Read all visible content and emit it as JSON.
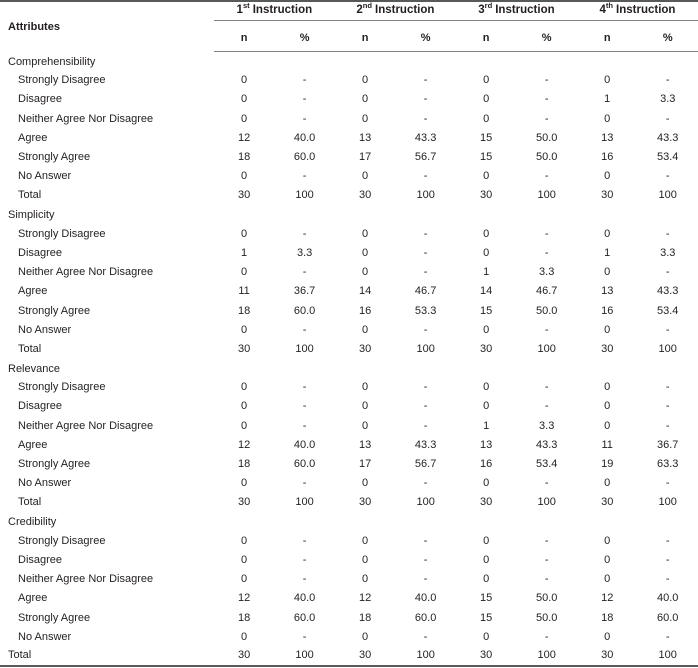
{
  "table": {
    "attributes_header": "Attributes",
    "column_groups": [
      {
        "ordinal": "1",
        "suffix": "st",
        "label": "Instruction"
      },
      {
        "ordinal": "2",
        "suffix": "nd",
        "label": "Instruction"
      },
      {
        "ordinal": "3",
        "suffix": "rd",
        "label": "Instruction"
      },
      {
        "ordinal": "4",
        "suffix": "th",
        "label": "Instruction"
      }
    ],
    "subheaders": [
      "n",
      "%",
      "n",
      "%",
      "n",
      "%",
      "n",
      "%"
    ],
    "sections": [
      {
        "name": "Comprehensibility",
        "rows": [
          {
            "label": "Strongly Disagree",
            "values": [
              "0",
              "-",
              "0",
              "-",
              "0",
              "-",
              "0",
              "-"
            ]
          },
          {
            "label": "Disagree",
            "values": [
              "0",
              "-",
              "0",
              "-",
              "0",
              "-",
              "1",
              "3.3"
            ]
          },
          {
            "label": "Neither Agree Nor Disagree",
            "values": [
              "0",
              "-",
              "0",
              "-",
              "0",
              "-",
              "0",
              "-"
            ]
          },
          {
            "label": "Agree",
            "values": [
              "12",
              "40.0",
              "13",
              "43.3",
              "15",
              "50.0",
              "13",
              "43.3"
            ]
          },
          {
            "label": "Strongly Agree",
            "values": [
              "18",
              "60.0",
              "17",
              "56.7",
              "15",
              "50.0",
              "16",
              "53.4"
            ]
          },
          {
            "label": "No Answer",
            "values": [
              "0",
              "-",
              "0",
              "-",
              "0",
              "-",
              "0",
              "-"
            ]
          },
          {
            "label": "Total",
            "values": [
              "30",
              "100",
              "30",
              "100",
              "30",
              "100",
              "30",
              "100"
            ]
          }
        ]
      },
      {
        "name": "Simplicity",
        "rows": [
          {
            "label": "Strongly Disagree",
            "values": [
              "0",
              "-",
              "0",
              "-",
              "0",
              "-",
              "0",
              "-"
            ]
          },
          {
            "label": "Disagree",
            "values": [
              "1",
              "3.3",
              "0",
              "-",
              "0",
              "-",
              "1",
              "3.3"
            ]
          },
          {
            "label": "Neither Agree Nor Disagree",
            "values": [
              "0",
              "-",
              "0",
              "-",
              "1",
              "3.3",
              "0",
              "-"
            ]
          },
          {
            "label": "Agree",
            "values": [
              "11",
              "36.7",
              "14",
              "46.7",
              "14",
              "46.7",
              "13",
              "43.3"
            ]
          },
          {
            "label": "Strongly Agree",
            "values": [
              "18",
              "60.0",
              "16",
              "53.3",
              "15",
              "50.0",
              "16",
              "53.4"
            ]
          },
          {
            "label": "No Answer",
            "values": [
              "0",
              "-",
              "0",
              "-",
              "0",
              "-",
              "0",
              "-"
            ]
          },
          {
            "label": "Total",
            "values": [
              "30",
              "100",
              "30",
              "100",
              "30",
              "100",
              "30",
              "100"
            ]
          }
        ]
      },
      {
        "name": "Relevance",
        "rows": [
          {
            "label": "Strongly Disagree",
            "values": [
              "0",
              "-",
              "0",
              "-",
              "0",
              "-",
              "0",
              "-"
            ]
          },
          {
            "label": "Disagree",
            "values": [
              "0",
              "-",
              "0",
              "-",
              "0",
              "-",
              "0",
              "-"
            ]
          },
          {
            "label": "Neither Agree Nor Disagree",
            "values": [
              "0",
              "-",
              "0",
              "-",
              "1",
              "3.3",
              "0",
              "-"
            ]
          },
          {
            "label": "Agree",
            "values": [
              "12",
              "40.0",
              "13",
              "43.3",
              "13",
              "43.3",
              "11",
              "36.7"
            ]
          },
          {
            "label": "Strongly Agree",
            "values": [
              "18",
              "60.0",
              "17",
              "56.7",
              "16",
              "53.4",
              "19",
              "63.3"
            ]
          },
          {
            "label": "No Answer",
            "values": [
              "0",
              "-",
              "0",
              "-",
              "0",
              "-",
              "0",
              "-"
            ]
          },
          {
            "label": "Total",
            "values": [
              "30",
              "100",
              "30",
              "100",
              "30",
              "100",
              "30",
              "100"
            ]
          }
        ]
      },
      {
        "name": "Credibility",
        "rows": [
          {
            "label": "Strongly Disagree",
            "values": [
              "0",
              "-",
              "0",
              "-",
              "0",
              "-",
              "0",
              "-"
            ]
          },
          {
            "label": "Disagree",
            "values": [
              "0",
              "-",
              "0",
              "-",
              "0",
              "-",
              "0",
              "-"
            ]
          },
          {
            "label": "Neither Agree Nor Disagree",
            "values": [
              "0",
              "-",
              "0",
              "-",
              "0",
              "-",
              "0",
              "-"
            ]
          },
          {
            "label": "Agree",
            "values": [
              "12",
              "40.0",
              "12",
              "40.0",
              "15",
              "50.0",
              "12",
              "40.0"
            ]
          },
          {
            "label": "Strongly Agree",
            "values": [
              "18",
              "60.0",
              "18",
              "60.0",
              "15",
              "50.0",
              "18",
              "60.0"
            ]
          },
          {
            "label": "No Answer",
            "values": [
              "0",
              "-",
              "0",
              "-",
              "0",
              "-",
              "0",
              "-"
            ]
          }
        ]
      }
    ],
    "grand_total": {
      "label": "Total",
      "values": [
        "30",
        "100",
        "30",
        "100",
        "30",
        "100",
        "30",
        "100"
      ]
    }
  }
}
